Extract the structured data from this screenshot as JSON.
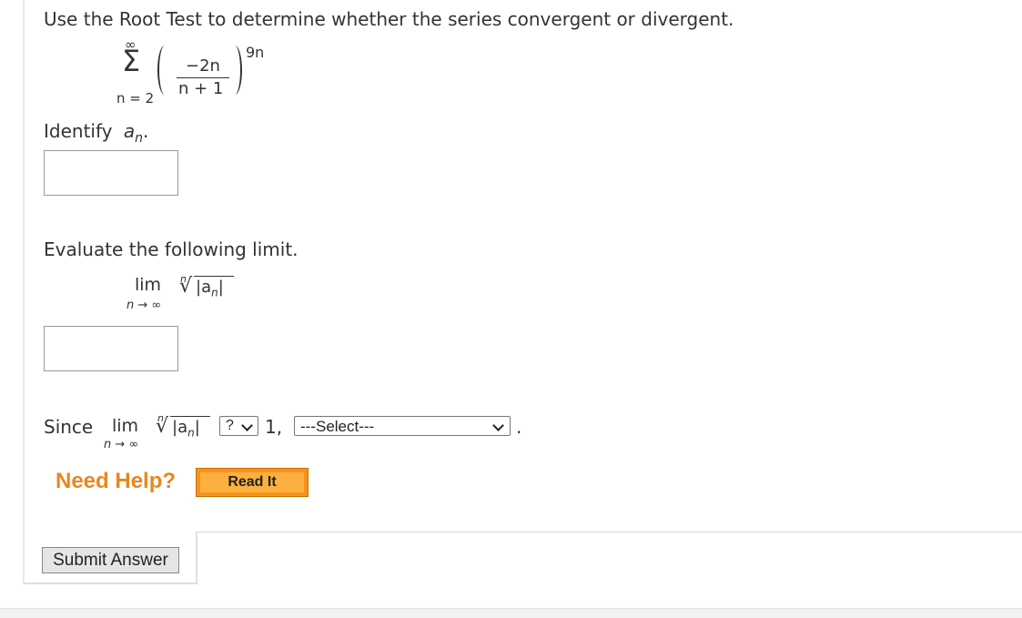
{
  "question": {
    "prompt": "Use the Root Test to determine whether the series convergent or divergent.",
    "series": {
      "sum_symbol": "Σ",
      "upper": "∞",
      "lower": "n = 2",
      "numerator": "−2n",
      "denominator": "n + 1",
      "exponent": "9n"
    }
  },
  "part1": {
    "label_prefix": "Identify ",
    "a_symbol": "a",
    "a_sub": "n",
    "label_suffix": "."
  },
  "part2": {
    "label": "Evaluate the following limit.",
    "lim": "lim",
    "lim_sub": "n → ∞",
    "root_index": "n",
    "radical": "√",
    "abs_open": "|a",
    "abs_sub": "n",
    "abs_close": "|"
  },
  "part3": {
    "since": "Since",
    "lim": "lim",
    "lim_sub": "n → ∞",
    "root_index": "n",
    "radical": "√",
    "abs_open": "|a",
    "abs_sub": "n",
    "abs_close": "|",
    "compare_select_value": "?",
    "one_comma": "1,",
    "conclusion_select_value": "---Select---",
    "period": "."
  },
  "help": {
    "need_help": "Need Help?",
    "read_it": "Read It"
  },
  "submit": {
    "label": "Submit Answer"
  }
}
